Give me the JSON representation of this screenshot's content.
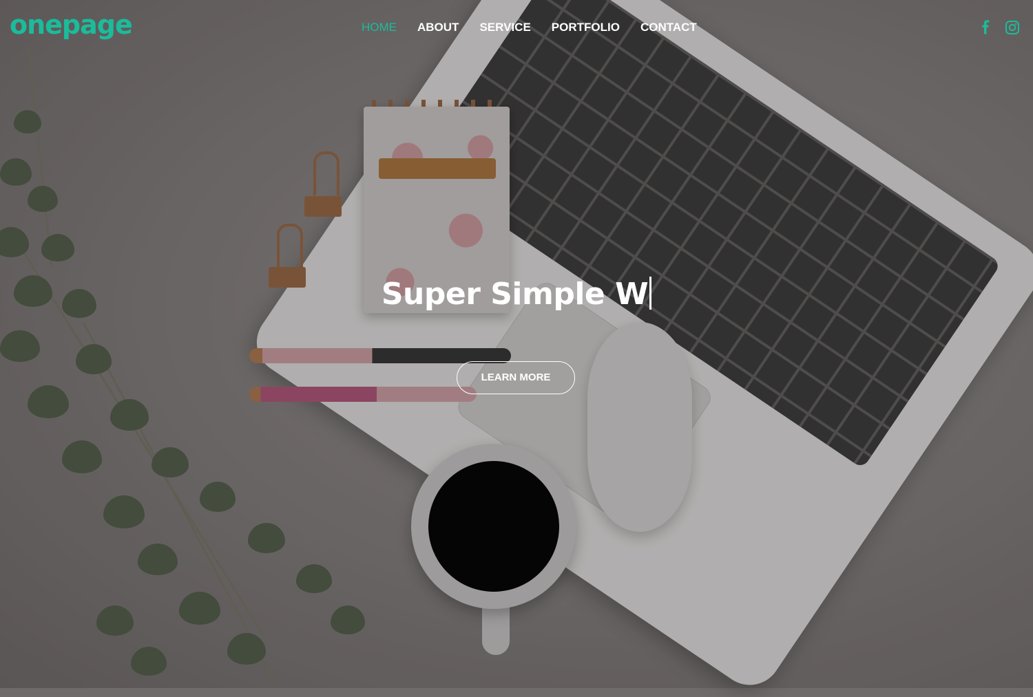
{
  "brand": {
    "logo_text": "onepage",
    "accent_color": "#1bbc9b"
  },
  "nav": {
    "items": [
      {
        "label": "HOME",
        "active": true
      },
      {
        "label": "ABOUT",
        "active": false
      },
      {
        "label": "SERVICE",
        "active": false
      },
      {
        "label": "PORTFOLIO",
        "active": false
      },
      {
        "label": "CONTACT",
        "active": false
      }
    ]
  },
  "social": {
    "icons": [
      "facebook-icon",
      "instagram-icon"
    ]
  },
  "hero": {
    "headline": "Super Simple W",
    "cta_label": "LEARN MORE",
    "background": "desk-workspace-photo"
  }
}
